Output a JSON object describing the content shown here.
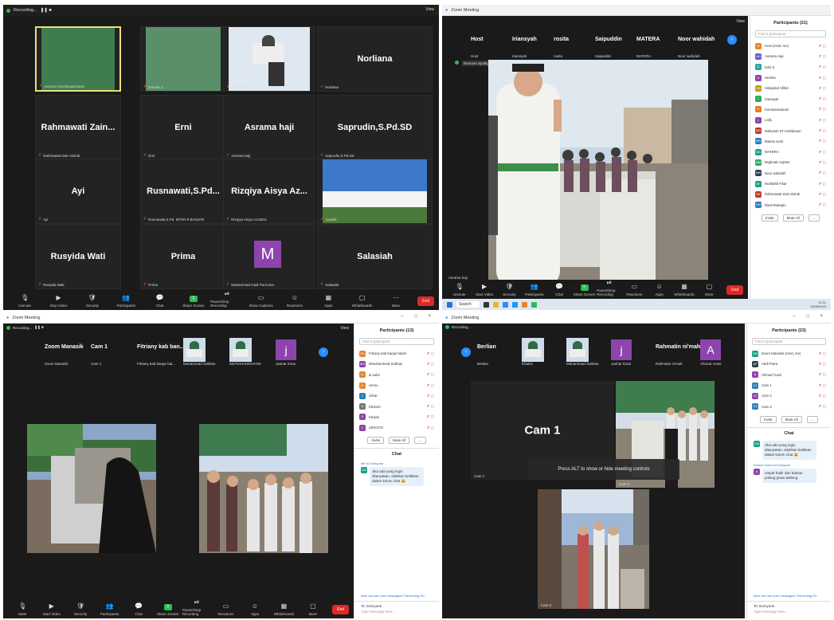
{
  "q1": {
    "titlebar": {
      "recording": "Recording...",
      "view": "View"
    },
    "tiles": [
      {
        "name": "",
        "tag": "Asrama Haji Banjarmasin"
      },
      {
        "name": "",
        "tag": "SALWA 1"
      },
      {
        "name": "",
        "tag": "RADIO SMS"
      },
      {
        "name": "Norliana",
        "tag": "Norliana"
      },
      {
        "name": "Rahmawati Zain...",
        "tag": "Rahmawati Zain Muhdi"
      },
      {
        "name": "Erni",
        "tag": "Erni"
      },
      {
        "name": "Asrama haji",
        "tag": "Asrama haji"
      },
      {
        "name": "Saprudin,S.Pd.SD",
        "tag": "Saprudin,S.Pd.SD"
      },
      {
        "name": "Ayi",
        "tag": "Ayi"
      },
      {
        "name": "Rusnawati,S.Pd...",
        "tag": "Rusnawati,S.Pd. MTSN 9 BANJAR"
      },
      {
        "name": "Rizqiya Aisya Az...",
        "tag": "Rizqiya Aisya Azzahra"
      },
      {
        "name": "",
        "tag": "Jurasik"
      },
      {
        "name": "Rusyida Wati",
        "tag": "Rusyida Wati"
      },
      {
        "name": "Prima",
        "tag": "Prima"
      },
      {
        "name": "M",
        "tag": "Muhammad Hadi Purnomo"
      },
      {
        "name": "Salasiah",
        "tag": "Salasiah"
      }
    ],
    "toolbar": [
      "Unmute",
      "Stop Video",
      "Security",
      "Participants",
      "Chat",
      "Share Screen",
      "Pause/Stop Recording",
      "Show Captions",
      "Reactions",
      "Apps",
      "Whiteboards",
      "More"
    ],
    "end": "End"
  },
  "q2": {
    "title": "Zoom Meeting",
    "strip": [
      {
        "name": "Host",
        "tag": "Host"
      },
      {
        "name": "Iriansyah",
        "tag": "Iriansyah"
      },
      {
        "name": "rosita",
        "tag": "rosita"
      },
      {
        "name": "Saipuddin",
        "tag": "Saipuddin"
      },
      {
        "name": "MATERA",
        "tag": "MATERA"
      },
      {
        "name": "Noor wahidah",
        "tag": "Noor wahidah"
      }
    ],
    "spotlight": "Remove Spotlight",
    "recording": "Recording...",
    "main_tag": "Asrama haji",
    "view": "View",
    "participants_title": "Participants (21)",
    "search_placeholder": "Find a participant",
    "participants": [
      {
        "name": "Host (Host, me)",
        "initial": "H",
        "color": "#e9842d"
      },
      {
        "name": "Asrama Haji",
        "initial": "AH",
        "color": "#6a5acd"
      },
      {
        "name": "Dzki S",
        "initial": "D",
        "color": "#2ea3a3"
      },
      {
        "name": "Herlina",
        "initial": "H",
        "color": "#8e44ad"
      },
      {
        "name": "Hidayatul Afifah",
        "initial": "HA",
        "color": "#c0a000"
      },
      {
        "name": "Iriansyah",
        "initial": "I",
        "color": "#27ae60"
      },
      {
        "name": "Kurniasiswanan",
        "initial": "K",
        "color": "#e67e22"
      },
      {
        "name": "Lally",
        "initial": "L",
        "color": "#8e44ad"
      },
      {
        "name": "Mahyanti ST Kebidanan",
        "initial": "MS",
        "color": "#c0392b"
      },
      {
        "name": "Mamia sonti",
        "initial": "MS",
        "color": "#2980b9"
      },
      {
        "name": "MATERA",
        "initial": "MA",
        "color": "#16a085"
      },
      {
        "name": "Mujtmati mujtam",
        "initial": "MM",
        "color": "#27ae60"
      },
      {
        "name": "Noor wahidah",
        "initial": "NW",
        "color": "#2c3e50"
      },
      {
        "name": "Nurfakhil Fikar",
        "initial": "NF",
        "color": "#16a085"
      },
      {
        "name": "Rahmawati Zain Muhdi",
        "initial": "RZ",
        "color": "#c0392b"
      },
      {
        "name": "Riad Mubaqin",
        "initial": "RM",
        "color": "#2980b9"
      }
    ],
    "invite": "Invite",
    "mute_all": "Mute All",
    "toolbar": [
      "Unmute",
      "Start Video",
      "Security",
      "Participants",
      "Chat",
      "Share Screen",
      "Pause/Stop Recording",
      "Reactions",
      "Apps",
      "Whiteboards",
      "More"
    ],
    "end": "End",
    "taskbar": {
      "search": "Search",
      "time": "17:21",
      "date": "13/05/2023"
    }
  },
  "q3": {
    "title": "Zoom Meeting",
    "recording": "Recording...",
    "view": "View",
    "strip": [
      {
        "name": "Zoom Manasik",
        "tag": "Zoom Manasik"
      },
      {
        "name": "Cam 1",
        "tag": "Cam 1"
      },
      {
        "name": "Fitriany kab ban...",
        "tag": "Fitriany kab banjar bal..."
      },
      {
        "name": "",
        "tag": "Muhammad Subhan"
      },
      {
        "name": "",
        "tag": "MUTIAHANDAYANI"
      },
      {
        "name": "j",
        "tag": "Jauhar Ibran"
      }
    ],
    "video_tags": [
      "Cam",
      "Cam 3"
    ],
    "participants_title": "Participants (13)",
    "search_placeholder": "Find a participant",
    "participants": [
      {
        "name": "Fitriany kab banjar babel",
        "initial": "FK",
        "color": "#e9842d"
      },
      {
        "name": "Mmuhammad Subhan",
        "initial": "MS",
        "color": "#8e44ad"
      },
      {
        "name": "ai sabri",
        "initial": "A",
        "color": "#e9842d"
      },
      {
        "name": "Hersu",
        "initial": "H",
        "color": "#e9842d"
      },
      {
        "name": "Johar",
        "initial": "J",
        "color": "#2980b9"
      },
      {
        "name": "Kharsel",
        "initial": "K",
        "color": "#777777"
      },
      {
        "name": "Khairis",
        "initial": "K",
        "color": "#8e44ad"
      },
      {
        "name": "LENOVO",
        "initial": "L",
        "color": "#8e44ad"
      }
    ],
    "invite": "Invite",
    "mute_all": "Mute All",
    "chat_title": "Chat",
    "chat_from": "Me to Everyone",
    "chat_msg": "Jika ada yang ingin ditanyakan, silahkan ketikkan dalam kolom chat 😀",
    "chat_note": "Who can see your messages? Recording On",
    "chat_to": "To: Everyone",
    "chat_input": "Type message here...",
    "toolbar": [
      "Mute",
      "Start Video",
      "Security",
      "Participants",
      "Chat",
      "Share Screen",
      "Pause/Stop Recording",
      "Reactions",
      "Apps",
      "Whiteboards",
      "More"
    ],
    "end": "End"
  },
  "q4": {
    "title": "Zoom Meeting",
    "recording": "Recording...",
    "view": "View",
    "strip": [
      {
        "name": "Berlian",
        "tag": "Berlian"
      },
      {
        "name": "",
        "tag": "Khairis"
      },
      {
        "name": "",
        "tag": "Muhammad Subhan"
      },
      {
        "name": "j",
        "tag": "Jauhar Ibran"
      },
      {
        "name": "Rahmatin ni'mah",
        "tag": "Rahmatin ni'mah"
      },
      {
        "name": "A",
        "tag": "Ahmad Yusni"
      }
    ],
    "cam_label": "Cam 1",
    "cam_tag": "Cam 1",
    "tag_small": "Cam 2",
    "tag_bottom": "Cam 3",
    "alt_msg": "Press ALT to show or hide meeting controls",
    "participants_title": "Participants (23)",
    "search_placeholder": "Find a participant",
    "participants": [
      {
        "name": "Zoom Manasik (Host, me)",
        "initial": "ZM",
        "color": "#16a085"
      },
      {
        "name": "Abdi Putra",
        "initial": "AP",
        "color": "#2c3e50"
      },
      {
        "name": "Ahmad Yusni",
        "initial": "A",
        "color": "#8e44ad"
      },
      {
        "name": "Cam 1",
        "initial": "C1",
        "color": "#2980b9"
      },
      {
        "name": "Cam 2",
        "initial": "C2",
        "color": "#8e44ad"
      },
      {
        "name": "Cam 3",
        "initial": "C3",
        "color": "#2980b9"
      }
    ],
    "invite": "Invite",
    "mute_all": "Mute All",
    "chat_title": "Chat",
    "chat_msg": "Jika ada yang ingin ditanyakan, silahkan ketikkan dalam kolom chat 😀",
    "chat_from2": "Ahmad Yusni to Everyone",
    "chat_msg2": "ompat hadir dari bahaur pulang pisau kalteng",
    "chat_note": "Who can see your messages? Recording On",
    "chat_to": "To: Everyone",
    "chat_input": "Type message here..."
  }
}
